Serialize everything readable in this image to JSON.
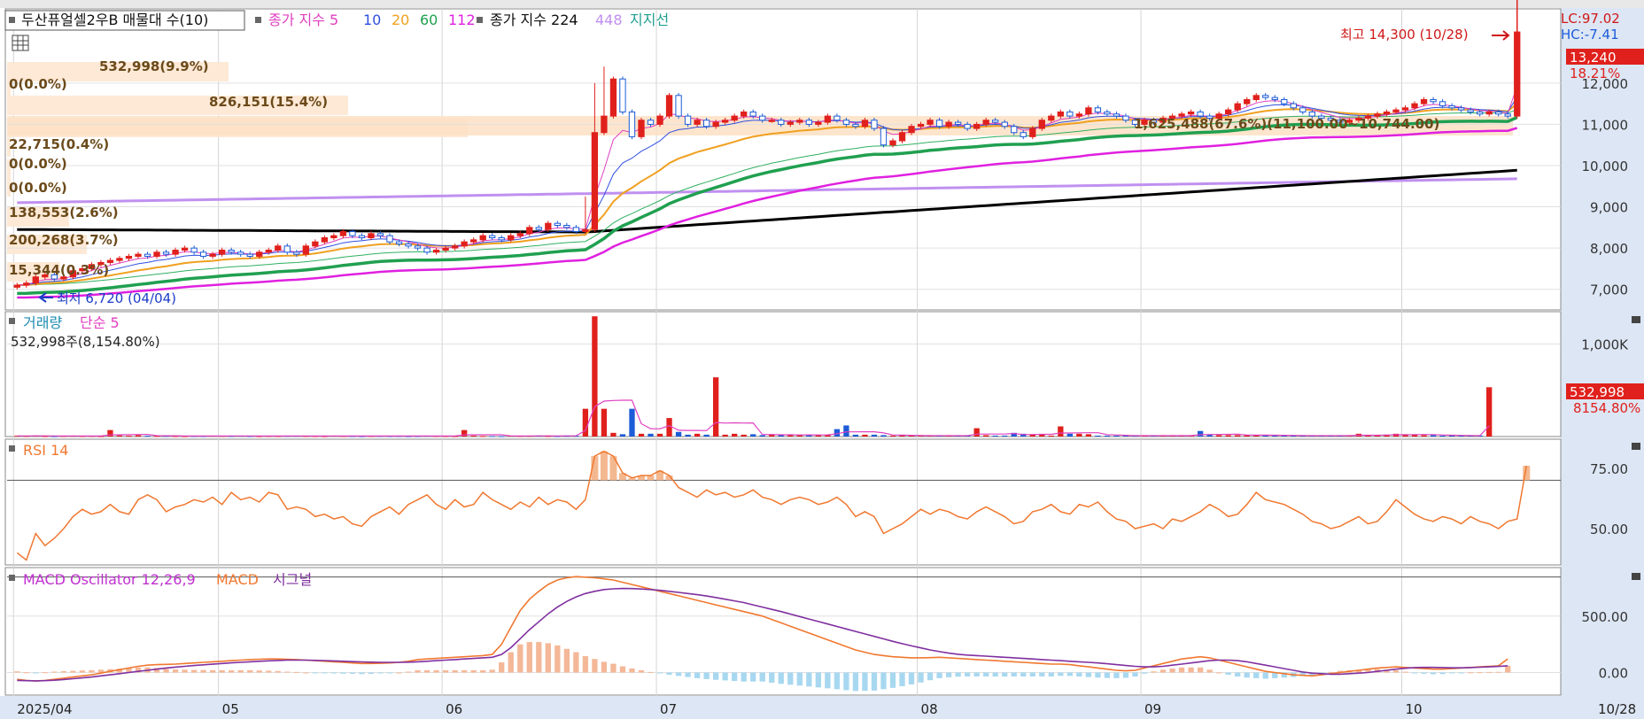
{
  "title": "두산퓨얼셀2우B 매물대 수(10)",
  "legend_price": {
    "item1": "종가 지수 5",
    "ma": [
      "10",
      "20",
      "60",
      "112"
    ],
    "item2": "종가 지수 224",
    "ma2": "448",
    "support": "지지선"
  },
  "colors": {
    "up": "#e0201c",
    "down": "#1c5cd8",
    "ma5": "#e040c0",
    "ma10": "#3050e0",
    "ma20": "#f0a020",
    "ma60": "#20a050",
    "ma112": "#e020e0",
    "ma224": "#000000",
    "ma448": "#c090f0",
    "support": "#20a090",
    "rsi": "#f07830",
    "macd_osc": "#c030d0",
    "macd": "#f07830",
    "signal": "#8030a0"
  },
  "right_labels": {
    "lc": "LC:97.02",
    "hc": "HC:-7.41",
    "price": "13,240",
    "price_pct": "18.21%",
    "volume": "532,998",
    "volume_pct": "8154.80%"
  },
  "annotations": {
    "high": "최고 14,300 (10/28)",
    "low": "최저 6,720 (04/04)",
    "mid_row": "1,625,488(67.6%)(11,100.00~10,744.00)"
  },
  "volume_profile": [
    "532,998(9.9%)",
    "0(0.0%)",
    "826,151(15.4%)",
    "22,715(0.4%)",
    "0(0.0%)",
    "0(0.0%)",
    "138,553(2.6%)",
    "200,268(3.7%)",
    "15,344(0.3%)"
  ],
  "panels": {
    "volume_title": "거래량",
    "volume_ma": "단순 5",
    "volume_value": "532,998주(8,154.80%)",
    "rsi_title": "RSI 14",
    "macd_title": "MACD Oscillator 12,26,9",
    "macd_name": "MACD",
    "signal_name": "시그널"
  },
  "x_labels": [
    "2025/04",
    "05",
    "06",
    "07",
    "08",
    "09",
    "10"
  ],
  "x_last": "10/28",
  "chart_data": {
    "type": "candlestick",
    "title": "두산퓨얼셀2우B",
    "price_ticks": [
      "7,000",
      "8,000",
      "9,000",
      "10,000",
      "11,000",
      "12,000"
    ],
    "price_tick_values": [
      7000,
      8000,
      9000,
      10000,
      11000,
      12000
    ],
    "price_range": [
      6500,
      13800
    ],
    "volume_ticks": [
      "1,000K"
    ],
    "volume_tick_values": [
      1000
    ],
    "volume_range": [
      0,
      1350
    ],
    "rsi_ticks": [
      "75.00",
      "50.00"
    ],
    "rsi_tick_values": [
      75,
      50
    ],
    "rsi_range": [
      35,
      87
    ],
    "macd_ticks": [
      "500.00",
      "0.00"
    ],
    "macd_tick_values": [
      500,
      0
    ],
    "macd_range": [
      -200,
      930
    ],
    "months": [
      "2025/04",
      "05",
      "06",
      "07",
      "08",
      "09",
      "10"
    ],
    "close_series": [
      7100,
      7150,
      7300,
      7350,
      7250,
      7300,
      7450,
      7500,
      7600,
      7650,
      7700,
      7750,
      7800,
      7850,
      7800,
      7900,
      7850,
      7950,
      8000,
      7900,
      7800,
      7850,
      7950,
      7900,
      7850,
      7800,
      7900,
      7950,
      8050,
      7900,
      7850,
      8050,
      8150,
      8250,
      8300,
      8400,
      8300,
      8250,
      8350,
      8300,
      8150,
      8100,
      8050,
      8000,
      7900,
      7950,
      8000,
      8050,
      8150,
      8200,
      8300,
      8250,
      8200,
      8300,
      8350,
      8500,
      8450,
      8600,
      8550,
      8500,
      8400,
      8450,
      10800,
      11200,
      12100,
      11300,
      10700,
      11100,
      11000,
      11200,
      11700,
      11200,
      11000,
      11100,
      10950,
      11050,
      11100,
      11200,
      11300,
      11200,
      11100,
      11100,
      11000,
      11050,
      11100,
      11000,
      11050,
      11200,
      11100,
      11000,
      10950,
      11100,
      10900,
      10500,
      10600,
      10800,
      10950,
      11000,
      11100,
      10950,
      11050,
      11000,
      10900,
      11000,
      11100,
      11050,
      10950,
      10800,
      10700,
      10900,
      11100,
      11200,
      11300,
      11200,
      11250,
      11400,
      11300,
      11250,
      11200,
      11100,
      11000,
      11100,
      11050,
      11150,
      11200,
      11250,
      11300,
      11200,
      11150,
      11250,
      11350,
      11500,
      11600,
      11700,
      11650,
      11600,
      11500,
      11400,
      11300,
      11200,
      11150,
      11100,
      11050,
      11100,
      11150,
      11200,
      11250,
      11300,
      11350,
      11400,
      11500,
      11600,
      11550,
      11450,
      11400,
      11350,
      11300,
      11250,
      11300,
      11250,
      11200,
      13240
    ],
    "volume_series": [
      8,
      6,
      10,
      5,
      4,
      6,
      8,
      5,
      6,
      4,
      70,
      12,
      9,
      15,
      8,
      6,
      7,
      5,
      4,
      6,
      5,
      8,
      7,
      6,
      9,
      5,
      4,
      6,
      5,
      7,
      8,
      6,
      5,
      4,
      9,
      6,
      5,
      4,
      6,
      7,
      5,
      6,
      4,
      5,
      8,
      6,
      5,
      4,
      70,
      10,
      6,
      5,
      4,
      9,
      6,
      8,
      10,
      6,
      5,
      7,
      8,
      300,
      1300,
      300,
      40,
      25,
      300,
      30,
      30,
      30,
      200,
      50,
      20,
      30,
      20,
      640,
      20,
      30,
      20,
      25,
      15,
      20,
      15,
      20,
      15,
      20,
      15,
      20,
      80,
      120,
      20,
      20,
      20,
      15,
      10,
      10,
      10,
      10,
      10,
      10,
      10,
      10,
      10,
      90,
      15,
      10,
      10,
      40,
      30,
      20,
      20,
      10,
      110,
      30,
      30,
      25,
      10,
      10,
      10,
      10,
      10,
      10,
      10,
      10,
      10,
      10,
      10,
      60,
      20,
      15,
      15,
      15,
      15,
      15,
      15,
      10,
      10,
      10,
      10,
      10,
      10,
      10,
      10,
      10,
      30,
      10,
      10,
      20,
      30,
      25,
      20,
      15,
      15,
      10,
      10,
      10,
      10,
      10,
      533
    ],
    "rsi_series": [
      40,
      37,
      48,
      43,
      46,
      50,
      55,
      58,
      56,
      57,
      60,
      57,
      56,
      62,
      64,
      62,
      57,
      59,
      60,
      62,
      61,
      63,
      60,
      65,
      62,
      63,
      61,
      65,
      64,
      58,
      59,
      58,
      55,
      56,
      54,
      55,
      52,
      51,
      55,
      57,
      59,
      56,
      60,
      62,
      64,
      60,
      58,
      62,
      59,
      60,
      65,
      62,
      60,
      58,
      61,
      59,
      63,
      60,
      62,
      61,
      58,
      62,
      80,
      82,
      80,
      73,
      71,
      72,
      72,
      74,
      72,
      67,
      65,
      63,
      66,
      64,
      65,
      63,
      64,
      66,
      63,
      62,
      60,
      62,
      63,
      62,
      60,
      61,
      63,
      60,
      55,
      57,
      55,
      48,
      50,
      52,
      55,
      58,
      56,
      58,
      57,
      55,
      54,
      57,
      59,
      57,
      55,
      52,
      53,
      57,
      58,
      60,
      57,
      56,
      60,
      59,
      61,
      57,
      54,
      53,
      50,
      51,
      52,
      50,
      54,
      53,
      55,
      57,
      60,
      58,
      55,
      56,
      60,
      65,
      62,
      61,
      60,
      58,
      56,
      53,
      52,
      50,
      51,
      53,
      55,
      52,
      53,
      57,
      62,
      59,
      56,
      54,
      53,
      55,
      54,
      52,
      55,
      53,
      52,
      50,
      53,
      54,
      76
    ],
    "macd_series": [
      -60,
      -70,
      -75,
      -70,
      -60,
      -50,
      -40,
      -30,
      -20,
      -5,
      10,
      25,
      40,
      55,
      65,
      70,
      72,
      75,
      80,
      85,
      90,
      95,
      100,
      105,
      110,
      115,
      118,
      120,
      120,
      118,
      115,
      110,
      105,
      100,
      95,
      90,
      85,
      80,
      80,
      82,
      85,
      90,
      100,
      115,
      120,
      125,
      130,
      135,
      140,
      145,
      150,
      160,
      250,
      400,
      550,
      650,
      720,
      780,
      820,
      840,
      850,
      845,
      840,
      830,
      820,
      800,
      780,
      760,
      740,
      720,
      700,
      680,
      660,
      640,
      620,
      600,
      580,
      560,
      540,
      520,
      500,
      470,
      440,
      410,
      380,
      350,
      320,
      290,
      260,
      230,
      200,
      180,
      160,
      150,
      140,
      135,
      130,
      130,
      132,
      135,
      130,
      125,
      120,
      115,
      110,
      105,
      100,
      95,
      90,
      85,
      80,
      75,
      75,
      70,
      60,
      50,
      40,
      30,
      20,
      15,
      20,
      40,
      60,
      80,
      100,
      120,
      130,
      140,
      130,
      110,
      90,
      70,
      50,
      30,
      10,
      0,
      -10,
      -20,
      -25,
      -30,
      -20,
      -10,
      0,
      10,
      20,
      30,
      40,
      45,
      50,
      45,
      40,
      35,
      30,
      30,
      35,
      40,
      45,
      50,
      55,
      60,
      120
    ],
    "signal_series": [
      -70,
      -72,
      -74,
      -72,
      -68,
      -62,
      -55,
      -48,
      -40,
      -30,
      -20,
      -10,
      0,
      10,
      20,
      30,
      40,
      48,
      55,
      62,
      68,
      74,
      80,
      86,
      90,
      95,
      100,
      104,
      107,
      110,
      110,
      110,
      108,
      106,
      103,
      100,
      97,
      94,
      92,
      90,
      90,
      90,
      92,
      95,
      100,
      105,
      110,
      115,
      120,
      125,
      130,
      135,
      160,
      220,
      300,
      380,
      450,
      520,
      580,
      630,
      670,
      700,
      720,
      735,
      742,
      745,
      744,
      740,
      735,
      728,
      720,
      710,
      700,
      690,
      678,
      665,
      650,
      635,
      620,
      600,
      580,
      560,
      540,
      518,
      496,
      474,
      452,
      430,
      408,
      386,
      364,
      342,
      320,
      298,
      276,
      256,
      236,
      218,
      200,
      185,
      172,
      162,
      155,
      150,
      145,
      140,
      135,
      130,
      125,
      120,
      115,
      110,
      105,
      100,
      95,
      90,
      85,
      78,
      70,
      62,
      55,
      50,
      50,
      55,
      65,
      75,
      85,
      95,
      105,
      110,
      110,
      105,
      95,
      80,
      65,
      50,
      35,
      20,
      5,
      -5,
      -10,
      -15,
      -15,
      -10,
      -5,
      0,
      10,
      20,
      30,
      38,
      44,
      46,
      46,
      44,
      42,
      42,
      44,
      47,
      50,
      54,
      60
    ]
  }
}
